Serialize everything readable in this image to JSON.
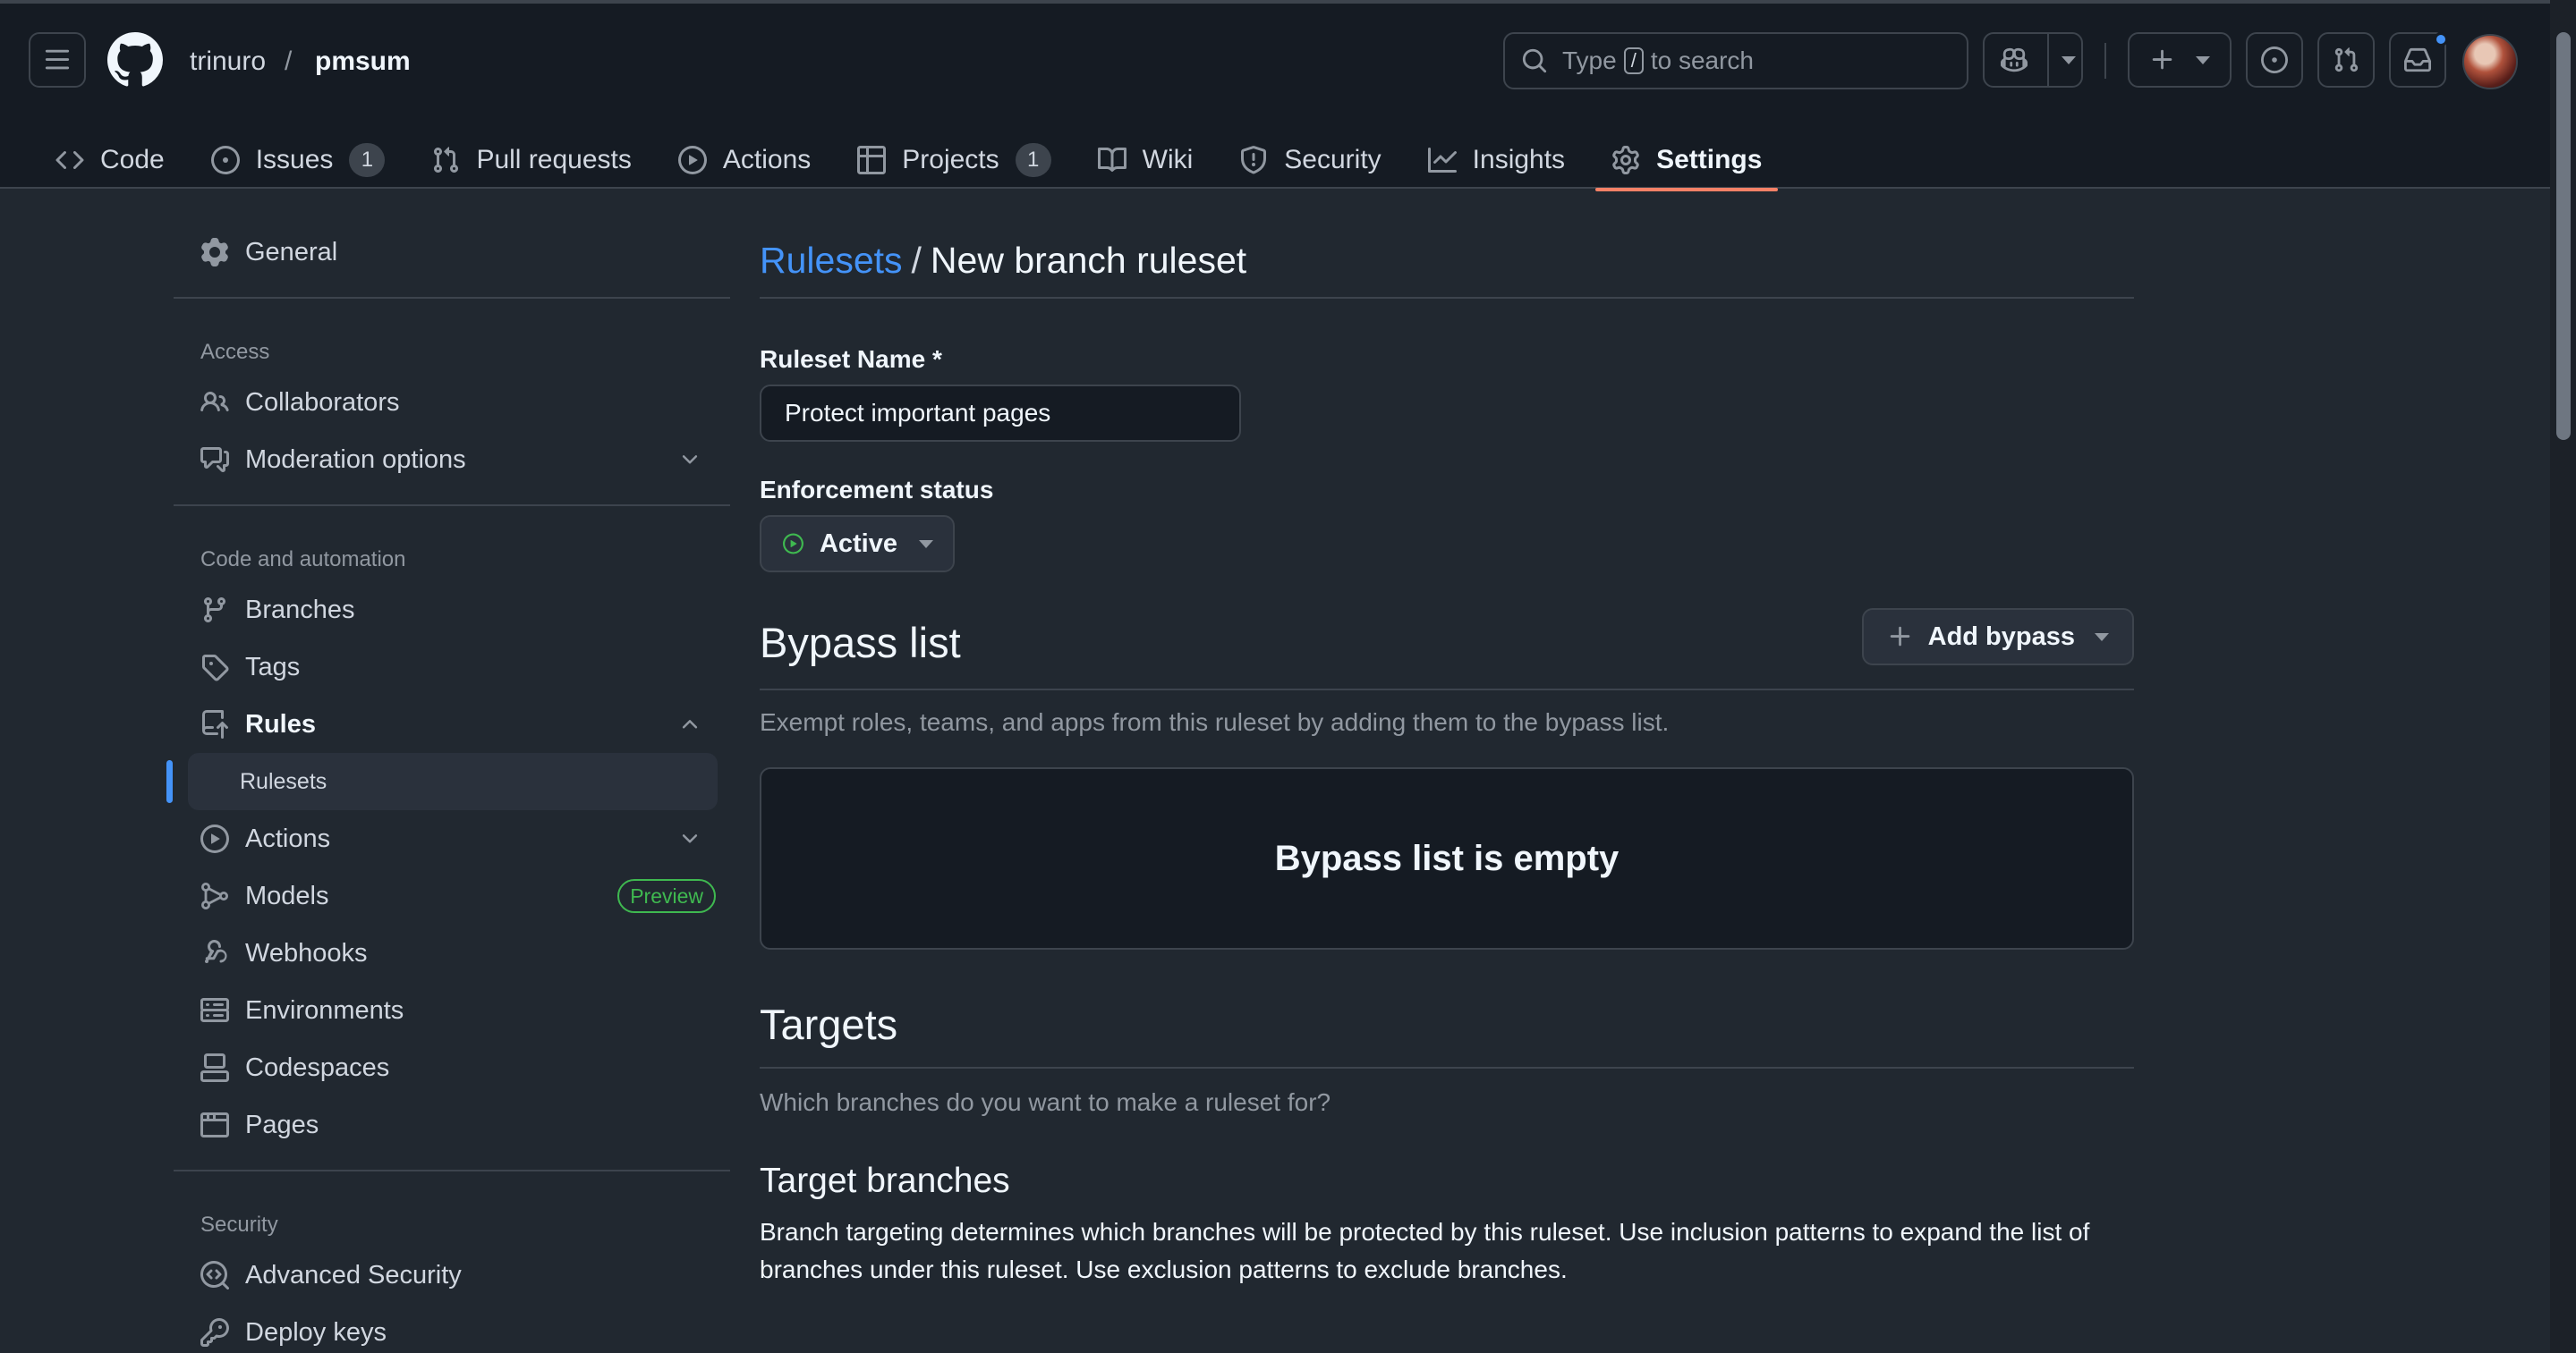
{
  "header": {
    "owner": "trinuro",
    "separator": "/",
    "repo": "pmsum",
    "search_prefix": "Type",
    "search_key": "/",
    "search_suffix": "to search"
  },
  "repo_tabs": [
    {
      "label": "Code",
      "icon": "code-icon"
    },
    {
      "label": "Issues",
      "icon": "issue-icon",
      "count": "1"
    },
    {
      "label": "Pull requests",
      "icon": "pull-request-icon"
    },
    {
      "label": "Actions",
      "icon": "play-icon"
    },
    {
      "label": "Projects",
      "icon": "table-icon",
      "count": "1"
    },
    {
      "label": "Wiki",
      "icon": "book-icon"
    },
    {
      "label": "Security",
      "icon": "shield-icon"
    },
    {
      "label": "Insights",
      "icon": "graph-icon"
    },
    {
      "label": "Settings",
      "icon": "gear-icon",
      "selected": true
    }
  ],
  "sidebar": {
    "general": "General",
    "access_heading": "Access",
    "collaborators": "Collaborators",
    "moderation": "Moderation options",
    "code_heading": "Code and automation",
    "branches": "Branches",
    "tags": "Tags",
    "rules": "Rules",
    "rulesets": "Rulesets",
    "actions": "Actions",
    "models": "Models",
    "models_badge": "Preview",
    "webhooks": "Webhooks",
    "environments": "Environments",
    "codespaces": "Codespaces",
    "pages": "Pages",
    "security_heading": "Security",
    "advanced_security": "Advanced Security",
    "deploy_keys": "Deploy keys"
  },
  "main": {
    "breadcrumb_link": "Rulesets",
    "breadcrumb_sep": "/",
    "page_title": "New branch ruleset",
    "name_label": "Ruleset Name *",
    "name_value": "Protect important pages",
    "enforcement_label": "Enforcement status",
    "enforcement_value": "Active",
    "bypass_title": "Bypass list",
    "add_bypass": "Add bypass",
    "bypass_desc": "Exempt roles, teams, and apps from this ruleset by adding them to the bypass list.",
    "bypass_empty": "Bypass list is empty",
    "targets_title": "Targets",
    "targets_desc": "Which branches do you want to make a ruleset for?",
    "target_branches_title": "Target branches",
    "target_branches_desc": "Branch targeting determines which branches will be protected by this ruleset. Use inclusion patterns to expand the list of branches under this ruleset. Use exclusion patterns to exclude branches."
  },
  "colors": {
    "accent_link": "#4493f8",
    "selected_tab_underline": "#f78166",
    "active_status": "#3fb950",
    "background": "#212830"
  }
}
